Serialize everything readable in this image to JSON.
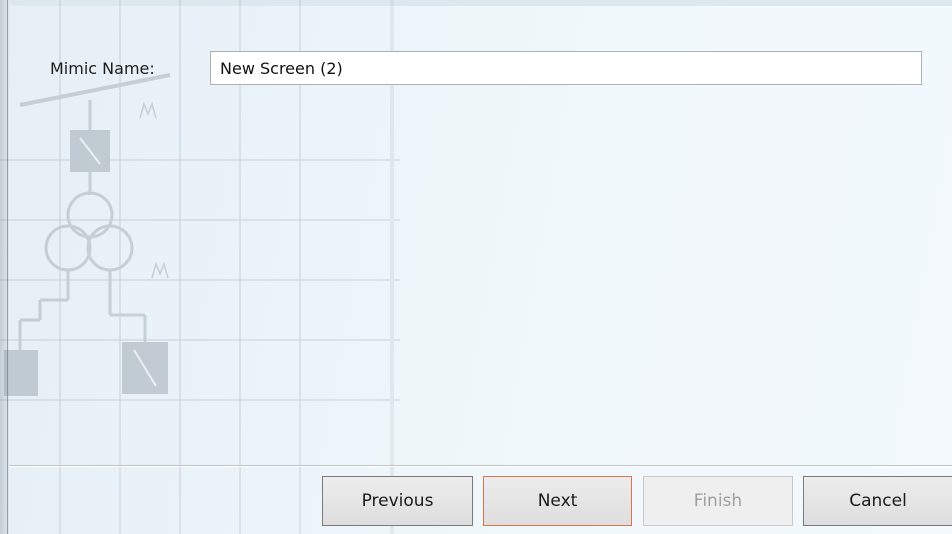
{
  "form": {
    "mimic_name_label": "Mimic Name:",
    "mimic_name_value": "New Screen (2)"
  },
  "buttons": {
    "previous": "Previous",
    "next": "Next",
    "finish": "Finish",
    "cancel": "Cancel"
  },
  "colors": {
    "dialog_background": "#eef5f9",
    "next_focus_border": "#d8744f",
    "disabled_text": "#a0a0a0"
  }
}
